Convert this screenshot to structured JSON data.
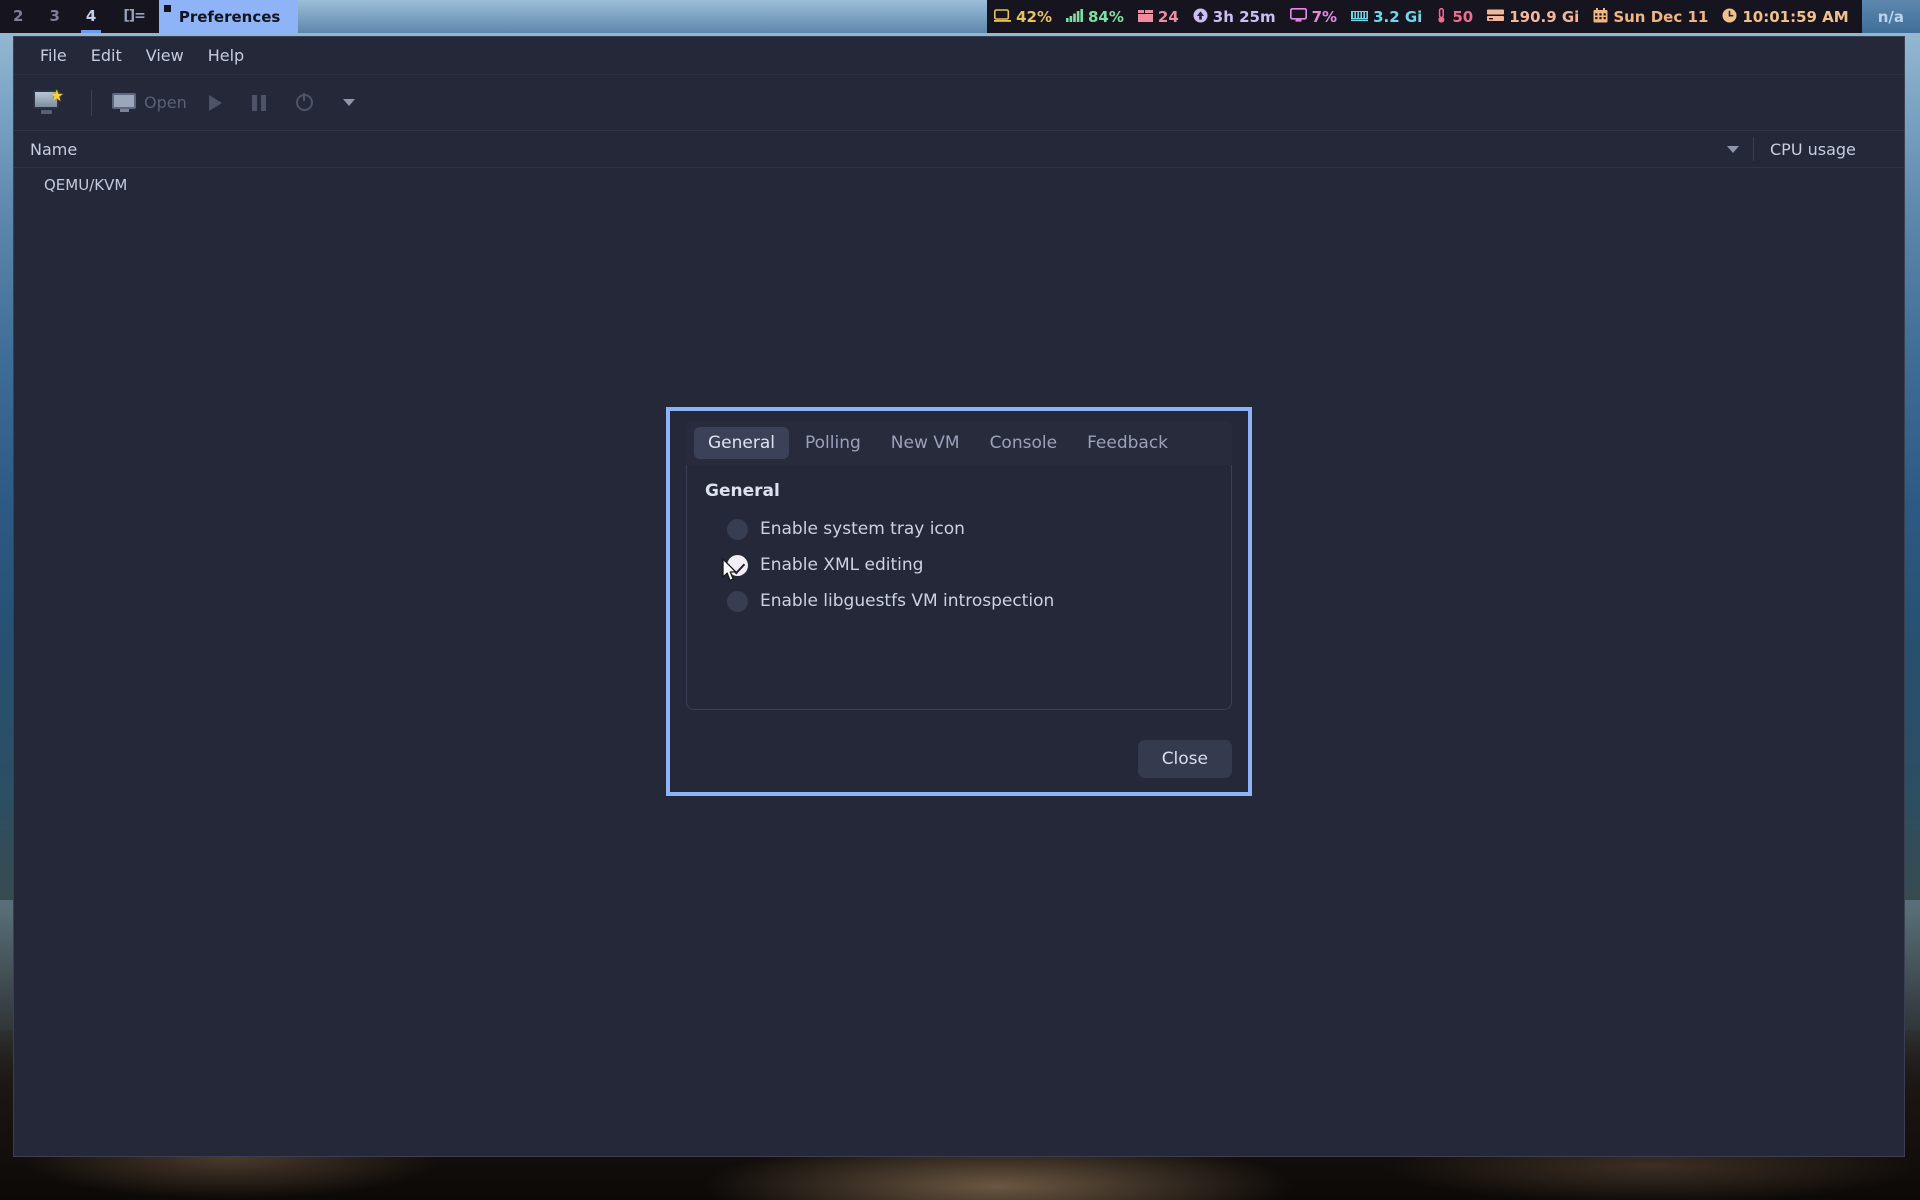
{
  "topbar": {
    "tags": [
      {
        "label": "2",
        "active": false
      },
      {
        "label": "3",
        "active": false
      },
      {
        "label": "4",
        "active": true
      }
    ],
    "layout_icon_label": "[]=",
    "window_title": "Preferences",
    "status_items": [
      {
        "name": "battery",
        "icon": "⬜",
        "value": "42%",
        "color": "#e8c25a"
      },
      {
        "name": "wifi",
        "icon": "█",
        "value": "84%",
        "color": "#7de0a0"
      },
      {
        "name": "packages",
        "icon": "▤",
        "value": "24",
        "color": "#f08ba0"
      },
      {
        "name": "uptime",
        "icon": "⬆",
        "value": "3h 25m",
        "color": "#cdbdf5"
      },
      {
        "name": "cpu",
        "icon": "▭",
        "value": "7%",
        "color": "#e38ae0"
      },
      {
        "name": "memory",
        "icon": "▓",
        "value": "3.2 Gi",
        "color": "#6fd8e8"
      },
      {
        "name": "temperature",
        "icon": "♨",
        "value": "50",
        "color": "#f06d8e"
      },
      {
        "name": "disk",
        "icon": "▥",
        "value": "190.9 Gi",
        "color": "#f2b79a"
      },
      {
        "name": "date",
        "icon": "▦",
        "value": "Sun Dec 11",
        "color": "#efb583"
      },
      {
        "name": "clock",
        "icon": "◔",
        "value": "10:01:59 AM",
        "color": "#f0c08a"
      }
    ],
    "na_label": "n/a"
  },
  "app": {
    "menus": [
      "File",
      "Edit",
      "View",
      "Help"
    ],
    "toolbar": {
      "new_vm_label": "",
      "open_label": "Open",
      "run_label": "",
      "pause_label": "",
      "shutdown_label": "",
      "more_label": ""
    },
    "list": {
      "columns": [
        "Name",
        "CPU usage"
      ],
      "rows": [
        {
          "name": "QEMU/KVM",
          "cpu": ""
        }
      ]
    }
  },
  "dialog": {
    "tabs": [
      {
        "label": "General",
        "active": true
      },
      {
        "label": "Polling",
        "active": false
      },
      {
        "label": "New VM",
        "active": false
      },
      {
        "label": "Console",
        "active": false
      },
      {
        "label": "Feedback",
        "active": false
      }
    ],
    "section_title": "General",
    "options": [
      {
        "label": "Enable system tray icon",
        "checked": false
      },
      {
        "label": "Enable XML editing",
        "checked": true
      },
      {
        "label": "Enable libguestfs VM introspection",
        "checked": false
      }
    ],
    "close_label": "Close",
    "border_color": "#8fb3f7"
  }
}
